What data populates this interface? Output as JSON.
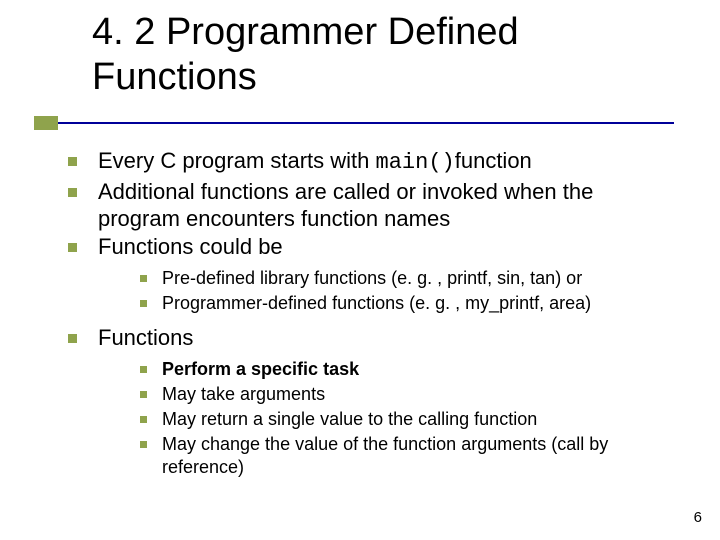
{
  "title": "4. 2 Programmer Defined Functions",
  "page_number": "6",
  "l1": {
    "i0a": "Every C program starts with ",
    "i0code": "main()",
    "i0b": "function",
    "i1": "Additional functions are called or invoked when the program encounters function names",
    "i2": "Functions could be",
    "i3": "Functions"
  },
  "l2a": {
    "i0": "Pre-defined library functions (e. g. , printf, sin, tan) or",
    "i1": "Programmer-defined functions (e. g. , my_printf, area)"
  },
  "l2b": {
    "i0": "Perform a specific task",
    "i1": "May take arguments",
    "i2": "May return a single value to the calling function",
    "i3": "May change the value of the function arguments (call by reference)"
  }
}
